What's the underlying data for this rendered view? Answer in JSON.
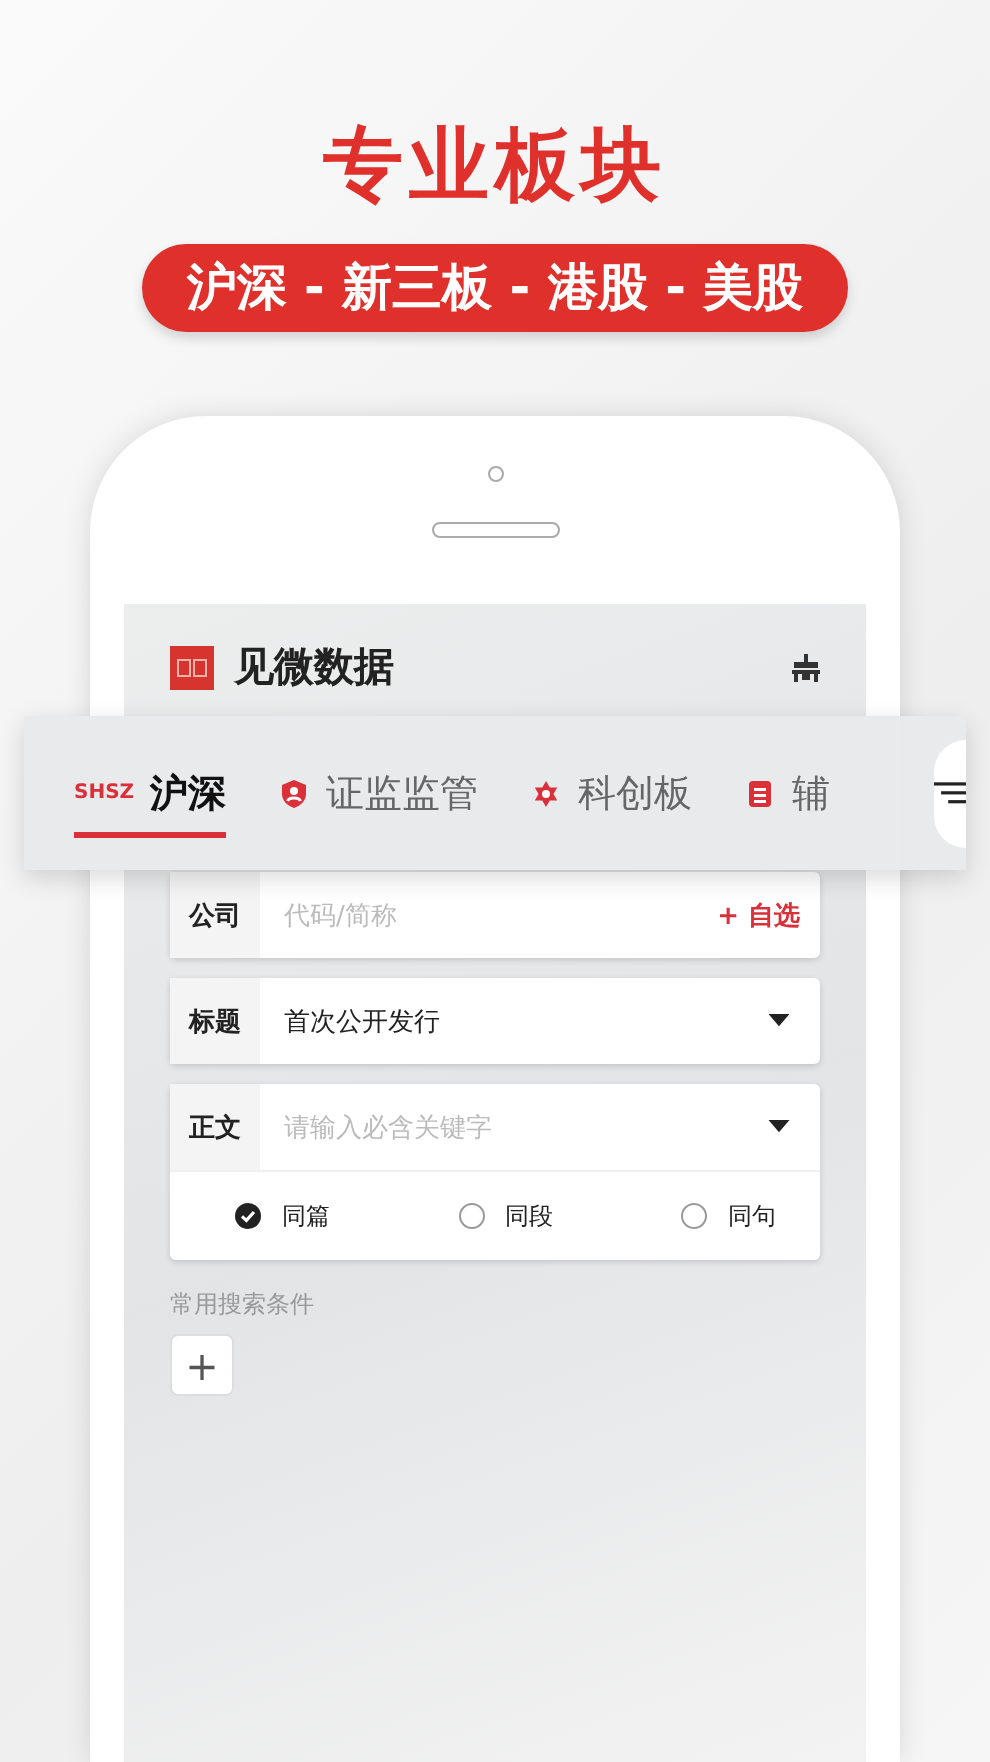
{
  "headline": "专业板块",
  "markets_banner": "沪深 - 新三板 - 港股 - 美股",
  "app": {
    "title": "见微数据"
  },
  "tabs": [
    {
      "kind": "mark",
      "mark": "SHSZ",
      "label": "沪深",
      "selected": true
    },
    {
      "kind": "shield",
      "label": "证监监管",
      "selected": false
    },
    {
      "kind": "star",
      "label": "科创板",
      "selected": false
    },
    {
      "kind": "clipboard",
      "label": "辅",
      "selected": false
    }
  ],
  "form": {
    "company": {
      "label": "公司",
      "placeholder": "代码/简称",
      "action": "+ 自选"
    },
    "title": {
      "label": "标题",
      "value": "首次公开发行"
    },
    "body": {
      "label": "正文",
      "placeholder": "请输入必含关键字"
    },
    "scope": [
      {
        "label": "同篇",
        "selected": true
      },
      {
        "label": "同段",
        "selected": false
      },
      {
        "label": "同句",
        "selected": false
      }
    ],
    "saved_label": "常用搜索条件",
    "add_button": "+"
  }
}
